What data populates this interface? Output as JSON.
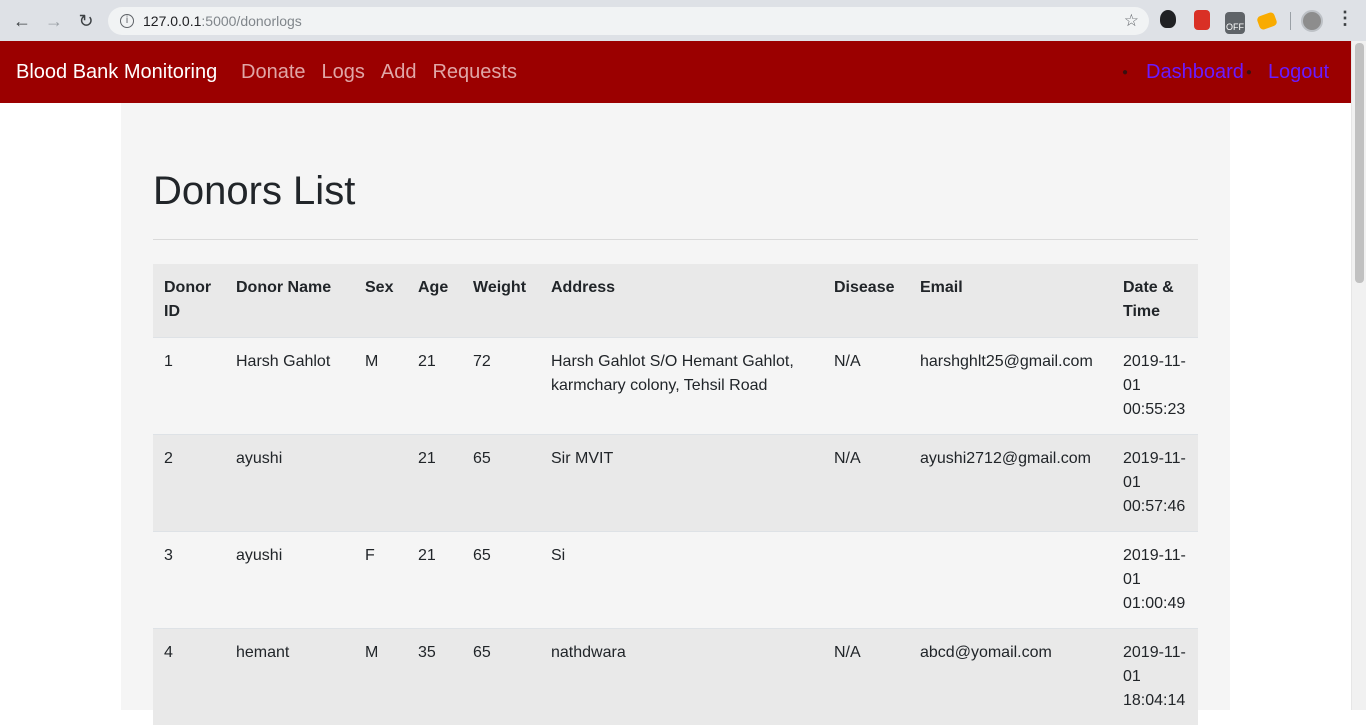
{
  "browser": {
    "url_host": "127.0.0.1",
    "url_path": ":5000/donorlogs",
    "ext3_label": "OFF"
  },
  "navbar": {
    "brand": "Blood Bank Monitoring",
    "links": [
      "Donate",
      "Logs",
      "Add",
      "Requests"
    ],
    "right_links": [
      "Dashboard",
      "Logout"
    ],
    "bg_color": "#9b0000"
  },
  "main": {
    "title": "Donors List",
    "table": {
      "headers": [
        "Donor ID",
        "Donor Name",
        "Sex",
        "Age",
        "Weight",
        "Address",
        "Disease",
        "Email",
        "Date & Time"
      ],
      "rows": [
        [
          "1",
          "Harsh Gahlot",
          "M",
          "21",
          "72",
          "Harsh Gahlot S/O Hemant Gahlot, karmchary colony, Tehsil Road",
          "N/A",
          "harshghlt25@gmail.com",
          "2019-11-01 00:55:23"
        ],
        [
          "2",
          "ayushi",
          "",
          "21",
          "65",
          "Sir MVIT",
          "N/A",
          "ayushi2712@gmail.com",
          "2019-11-01 00:57:46"
        ],
        [
          "3",
          "ayushi",
          "F",
          "21",
          "65",
          "Si",
          "",
          "",
          "2019-11-01 01:00:49"
        ],
        [
          "4",
          "hemant",
          "M",
          "35",
          "65",
          "nathdwara",
          "N/A",
          "abcd@yomail.com",
          "2019-11-01 18:04:14"
        ]
      ]
    }
  }
}
